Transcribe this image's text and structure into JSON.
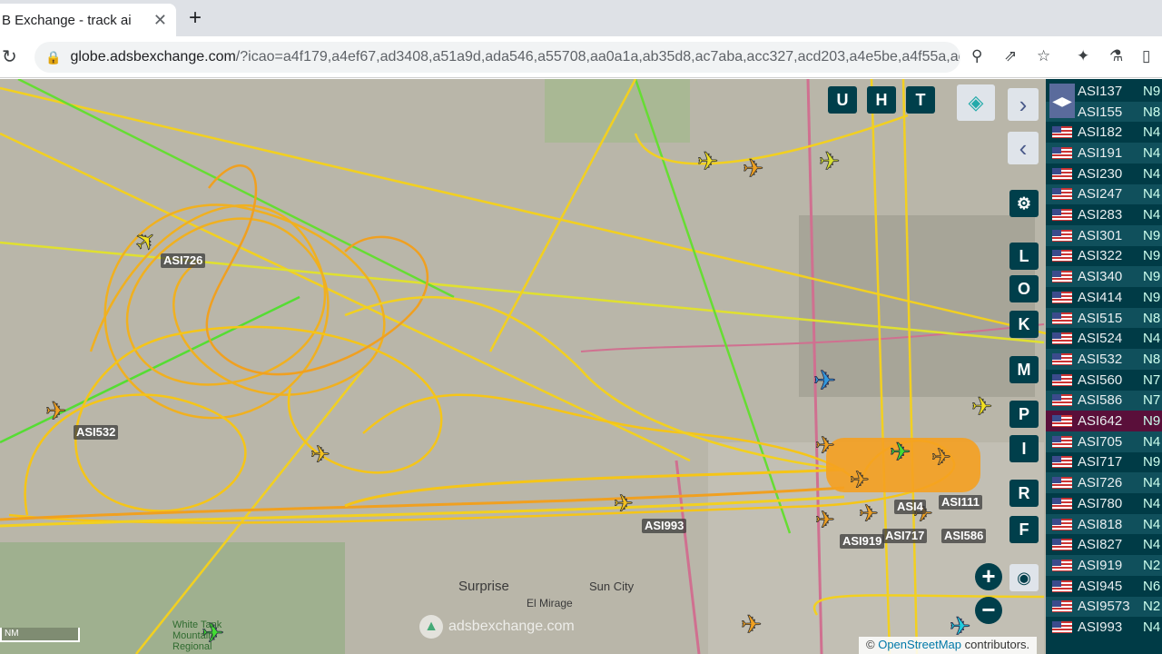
{
  "browser": {
    "tab_title": "B Exchange - track ai",
    "tab_close": "✕",
    "new_tab": "+",
    "url_host": "globe.adsbexchange.com",
    "url_rest": "/?icao=a4f179,a4ef67,ad3408,a51a9d,ada546,a55708,aa0a1a,ab35d8,ac7aba,acc327,acd203,a4e5be,a4f55a,ac...",
    "icons": [
      "reload-icon",
      "lock-icon",
      "location-icon",
      "share-icon",
      "star-icon",
      "extensions-icon",
      "lab-icon",
      "sidepanel-icon"
    ]
  },
  "map": {
    "aircraft_labels": [
      "ASI726",
      "ASI532",
      "ASI993",
      "ASI111",
      "ASI586",
      "ASI717",
      "ASI919",
      "ASI4"
    ],
    "towns": [
      "Surprise",
      "Sun City",
      "El Mirage",
      "White Tank Mountain Regional"
    ],
    "watermark": "adsbexchange.com",
    "scale_label": "NM",
    "attribution_prefix": "©",
    "attribution_link": "OpenStreetMap",
    "attribution_suffix": "contributors.",
    "top_buttons": [
      "U",
      "H",
      "T"
    ],
    "side_buttons": [
      "L",
      "O",
      "K",
      "M",
      "P",
      "I",
      "R",
      "F"
    ],
    "zoom_in": "+",
    "zoom_out": "−",
    "track_colors": {
      "primary": "#f5c518",
      "secondary": "#f0a020",
      "green": "#55dd33"
    }
  },
  "list": {
    "rows": [
      {
        "callsign": "ASI137",
        "reg": "N9"
      },
      {
        "callsign": "ASI155",
        "reg": "N8"
      },
      {
        "callsign": "ASI182",
        "reg": "N4"
      },
      {
        "callsign": "ASI191",
        "reg": "N4"
      },
      {
        "callsign": "ASI230",
        "reg": "N4"
      },
      {
        "callsign": "ASI247",
        "reg": "N4"
      },
      {
        "callsign": "ASI283",
        "reg": "N4"
      },
      {
        "callsign": "ASI301",
        "reg": "N9"
      },
      {
        "callsign": "ASI322",
        "reg": "N9"
      },
      {
        "callsign": "ASI340",
        "reg": "N9"
      },
      {
        "callsign": "ASI414",
        "reg": "N9"
      },
      {
        "callsign": "ASI515",
        "reg": "N8"
      },
      {
        "callsign": "ASI524",
        "reg": "N4"
      },
      {
        "callsign": "ASI532",
        "reg": "N8"
      },
      {
        "callsign": "ASI560",
        "reg": "N7"
      },
      {
        "callsign": "ASI586",
        "reg": "N7"
      },
      {
        "callsign": "ASI642",
        "reg": "N9"
      },
      {
        "callsign": "ASI705",
        "reg": "N4"
      },
      {
        "callsign": "ASI717",
        "reg": "N9"
      },
      {
        "callsign": "ASI726",
        "reg": "N4"
      },
      {
        "callsign": "ASI780",
        "reg": "N4"
      },
      {
        "callsign": "ASI818",
        "reg": "N4"
      },
      {
        "callsign": "ASI827",
        "reg": "N4"
      },
      {
        "callsign": "ASI919",
        "reg": "N2"
      },
      {
        "callsign": "ASI945",
        "reg": "N6"
      },
      {
        "callsign": "ASI9573",
        "reg": "N2"
      },
      {
        "callsign": "ASI993",
        "reg": "N4"
      }
    ],
    "selected": "ASI642"
  }
}
